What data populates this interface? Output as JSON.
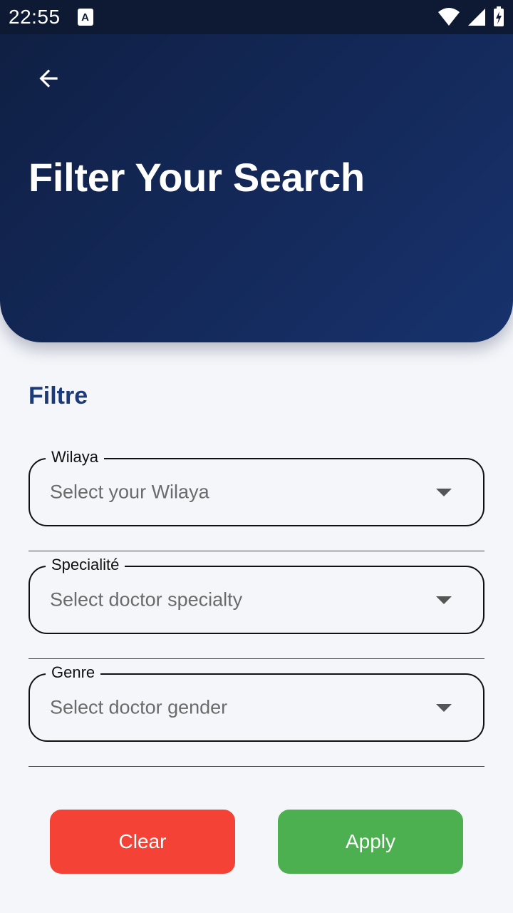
{
  "status_bar": {
    "time": "22:55",
    "notification_icon_letter": "A"
  },
  "header": {
    "back_icon": "arrow-left-icon",
    "title": "Filter Your Search"
  },
  "section": {
    "title": "Filtre"
  },
  "fields": [
    {
      "label": "Wilaya",
      "placeholder": "Select your Wilaya"
    },
    {
      "label": "Specialité",
      "placeholder": "Select doctor specialty"
    },
    {
      "label": "Genre",
      "placeholder": "Select doctor gender"
    }
  ],
  "buttons": {
    "clear_label": "Clear",
    "apply_label": "Apply"
  },
  "colors": {
    "header_dark": "#0f1f42",
    "header_light": "#17326d",
    "section_title": "#1c3a78",
    "clear_button": "#f44336",
    "apply_button": "#4caf50",
    "background": "#f4f6fa"
  }
}
